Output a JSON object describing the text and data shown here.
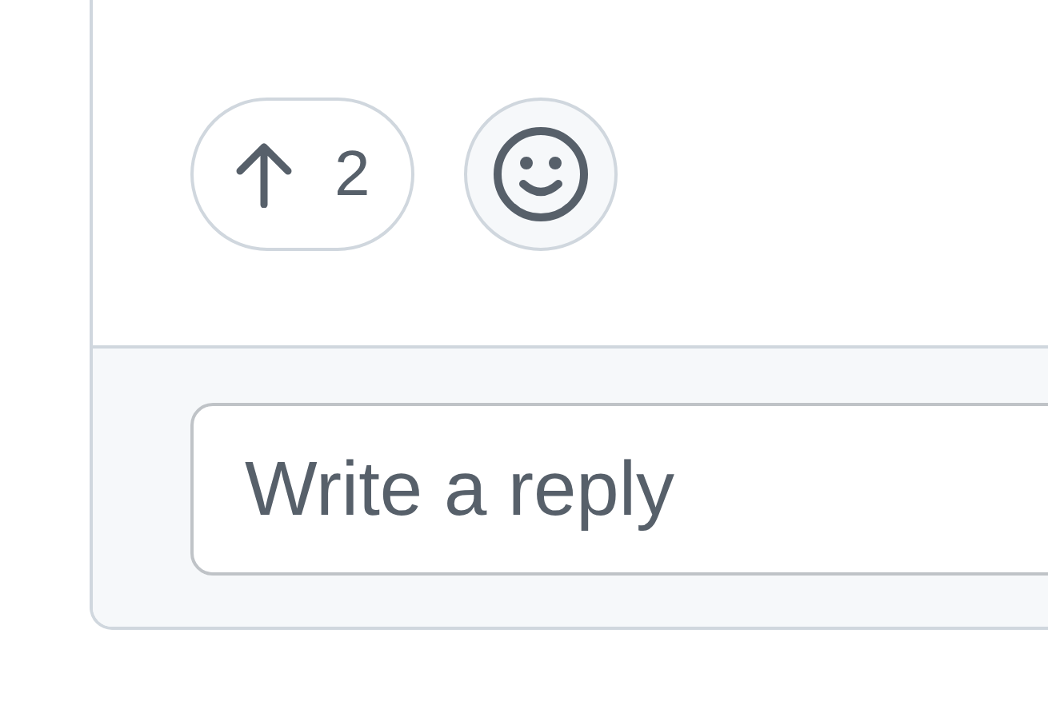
{
  "reactions": {
    "upvote_count": "2"
  },
  "reply": {
    "placeholder": "Write a reply"
  }
}
